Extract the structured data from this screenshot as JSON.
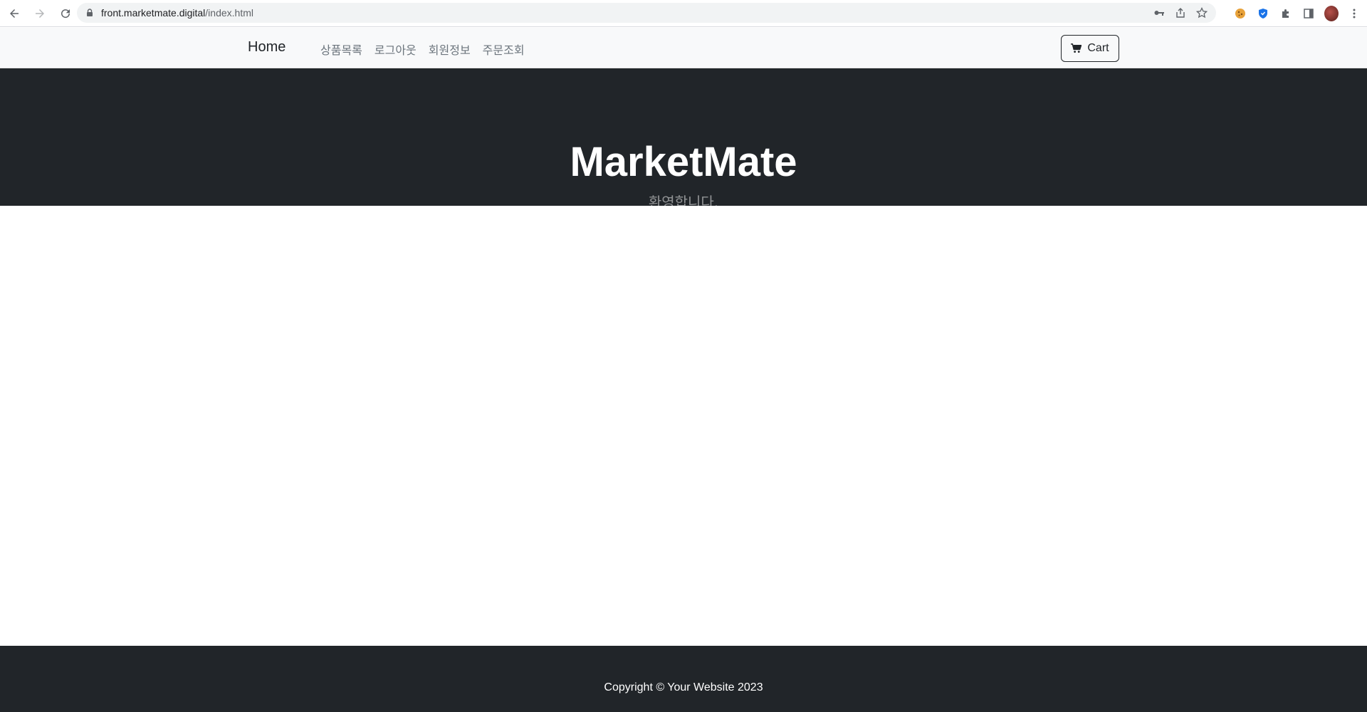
{
  "browser": {
    "url_host": "front.marketmate.digital",
    "url_path": "/index.html"
  },
  "navbar": {
    "brand": "Home",
    "links": [
      "상품목록",
      "로그아웃",
      "회원정보",
      "주문조회"
    ],
    "cart_label": "Cart"
  },
  "hero": {
    "title": "MarketMate",
    "subtitle": "환영합니다."
  },
  "footer": {
    "copyright": "Copyright © Your Website 2023"
  },
  "icons": {
    "back": "arrow-left-icon",
    "forward": "arrow-right-icon",
    "reload": "reload-icon",
    "lock": "lock-icon",
    "key": "key-icon",
    "share": "share-icon",
    "bookmark": "star-icon",
    "cookie": "cookie-icon",
    "shield": "shield-icon",
    "extensions": "puzzle-icon",
    "side_panel": "side-panel-icon",
    "menu": "kebab-menu-icon",
    "cart": "cart-icon"
  },
  "colors": {
    "hero_bg": "#212529",
    "nav_bg": "#f8f9fa",
    "footer_bg": "#212529",
    "link_muted": "#6c757d"
  }
}
